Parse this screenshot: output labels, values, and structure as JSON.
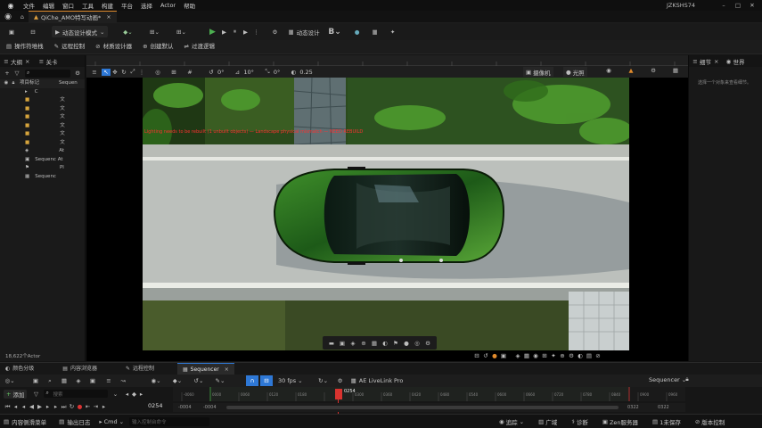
{
  "titlebar": {
    "menus": [
      "文件",
      "编辑",
      "窗口",
      "工具",
      "构建",
      "平台",
      "选择",
      "Actor",
      "帮助"
    ],
    "project_name": "JZKSHS74"
  },
  "tabbar": {
    "level_tab": "QiChe_AMO特写动画*"
  },
  "toolbar": {
    "mode": "动态设计模式",
    "cinematic": "动态设计"
  },
  "shortcuts": [
    "操作符堆栈",
    "远程控制",
    "材质设计器",
    "创建默认",
    "过渡逻辑"
  ],
  "outliner": {
    "tab_outliner": "大纲",
    "tab_levels": "关卡",
    "root": "项目标记",
    "sequence_col": "Sequen",
    "rows": [
      "C",
      "文",
      "文",
      "文",
      "文",
      "文",
      "文",
      "At",
      "Sequenc At",
      "Pl",
      "Sequenc"
    ],
    "actor_count": "18,622个Actor"
  },
  "viewport": {
    "fov_text": "10°",
    "speed_text": "0.25",
    "camera_btn": "摄像机",
    "lit_btn": "光照",
    "warning_text": "Lighting needs to be rebuilt (1 unbuilt objects) — Landscape physical mismatch — NEED REBUILD"
  },
  "details": {
    "tab_details": "细节",
    "tab_world": "世界",
    "empty_text": "选择一个对象来查看细节。"
  },
  "bottomtabs": {
    "tabs": [
      "颜色分级",
      "内容浏览器",
      "远程控制",
      "Sequencer"
    ],
    "active": "Sequencer"
  },
  "sequencer": {
    "add_btn": "添加",
    "search_placeholder": "搜索",
    "fps": "30 fps",
    "livelink": "AE LiveLink Pro",
    "seq_label": "Sequencer",
    "current_frame": "0254",
    "frame_start": "-0004",
    "frame_start2": "-0004",
    "frame_end": "0322",
    "frame_end2": "0322",
    "playhead_label": "0254",
    "ticks": [
      "-0060",
      "0000",
      "0060",
      "0120",
      "0180",
      "0240",
      "0300",
      "0360",
      "0420",
      "0480",
      "0540",
      "0600",
      "0660",
      "0720",
      "0780",
      "0840",
      "0900",
      "0960"
    ]
  },
  "statusbar": {
    "content_drawer": "内容侧滑菜单",
    "output_log": "输出日志",
    "cmd": "Cmd",
    "cmd_placeholder": "输入控制台命令",
    "trace": "追踪",
    "derived": "广域",
    "review": "诊断",
    "zen": "Zen服务器",
    "unsaved": "1未保存",
    "source_control": "版本控制"
  },
  "colors": {
    "accent_blue": "#2e78d6",
    "play_green": "#4caf50",
    "playhead_red": "#d8332f"
  }
}
